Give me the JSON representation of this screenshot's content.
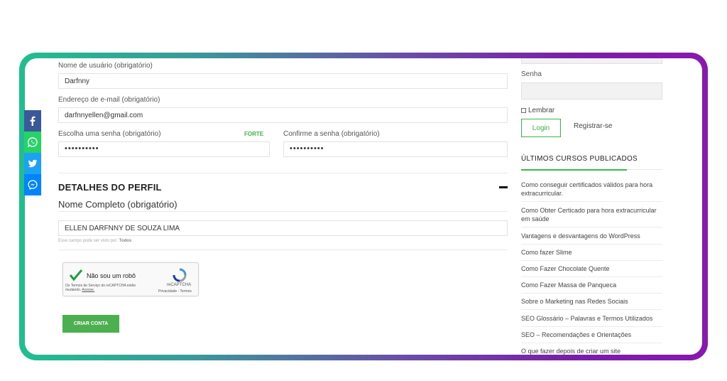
{
  "form": {
    "username_label": "Nome de usuário (obrigatório)",
    "username_value": "Darfnny",
    "email_label": "Endereço de e-mail (obrigatório)",
    "email_value": "darfnnyellen@gmail.com",
    "password_label": "Escolha uma senha (obrigatório)",
    "password_strength": "FORTE",
    "password_value": "••••••••••",
    "confirm_label": "Confirme a senha (obrigatório)",
    "confirm_value": "••••••••••"
  },
  "profile": {
    "section_title": "DETALHES DO PERFIL",
    "fullname_label": "Nome Completo (obrigatório)",
    "fullname_value": "ELLEN DARFNNY DE SOUZA LIMA",
    "visibility_hint": "Esse campo pode ser visto por:",
    "visibility_value": "Todos"
  },
  "captcha": {
    "label": "Não sou um robô",
    "brand": "reCAPTCHA",
    "terms_text": "Os Termos de Serviço do reCAPTCHA estão mudando.",
    "terms_link": "Acesse.",
    "privacy": "Privacidade",
    "separator": "-",
    "terms": "Termos"
  },
  "submit_label": "Criar conta",
  "sidebar": {
    "password_label": "Senha",
    "remember_label": "Lembrar",
    "login_label": "Login",
    "register_label": "Registrar-se",
    "courses_title": "ÚLTIMOS CURSOS PUBLICADOS",
    "courses": [
      "Como conseguir certificados válidos para hora extracurricular.",
      "Como Obter Certicado para hora extracurricular em saúde",
      "Vantagens e desvantagens do WordPress",
      "Como fazer Slime",
      "Como Fazer Chocolate Quente",
      "Como Fazer Massa de Panqueca",
      "Sobre o Marketing nas Redes Sociais",
      "SEO Glossário – Palavras e Termos Utilizados",
      "SEO – Recomendações e Orientações",
      "O que fazer depois de criar um site"
    ]
  },
  "share_bar": [
    {
      "icon": "facebook-icon",
      "color": "#3b5998"
    },
    {
      "icon": "whatsapp-icon",
      "color": "#25d366"
    },
    {
      "icon": "twitter-icon",
      "color": "#1da1f2"
    },
    {
      "icon": "messenger-icon",
      "color": "#0084ff"
    }
  ],
  "colors": {
    "accent_green": "#3cb54a",
    "button_green": "#4caf50",
    "frame_gradient_start": "#1fbf8f",
    "frame_gradient_end": "#8a18b0"
  }
}
